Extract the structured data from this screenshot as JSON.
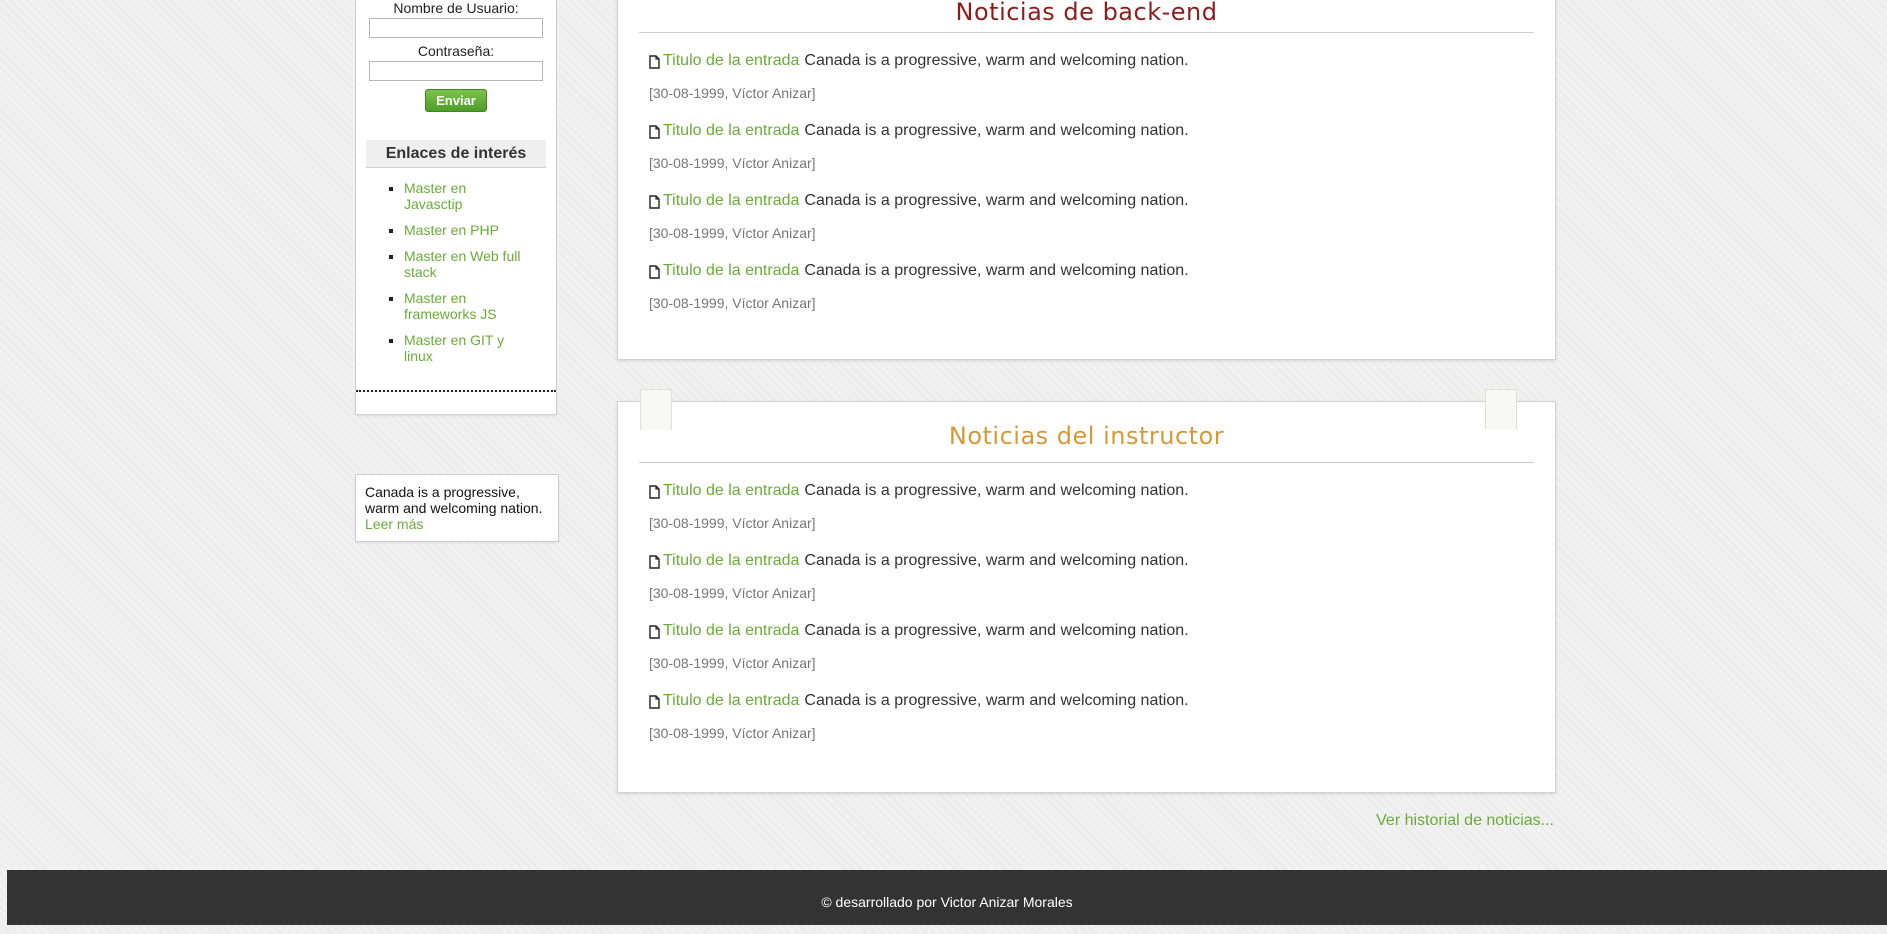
{
  "login": {
    "username_label": "Nombre de Usuario:",
    "password_label": "Contraseña:",
    "username_value": "",
    "password_value": "",
    "submit_label": "Enviar"
  },
  "links": {
    "title": "Enlaces de interés",
    "items": [
      {
        "label": "Master en Javasctip"
      },
      {
        "label": "Master en PHP"
      },
      {
        "label": "Master en Web full stack"
      },
      {
        "label": "Master en frameworks JS"
      },
      {
        "label": "Master en GIT y linux"
      }
    ]
  },
  "promo": {
    "text": "Canada is a progressive, warm and welcoming nation.",
    "link": "Leer más"
  },
  "sections": {
    "backend": {
      "title": "Noticias de back-end",
      "articles": [
        {
          "title": "Titulo de la entrada",
          "excerpt": "Canada is a progressive, warm and welcoming nation.",
          "meta": "[30-08-1999, Víctor Anizar]"
        },
        {
          "title": "Titulo de la entrada",
          "excerpt": "Canada is a progressive, warm and welcoming nation.",
          "meta": "[30-08-1999, Víctor Anizar]"
        },
        {
          "title": "Titulo de la entrada",
          "excerpt": "Canada is a progressive, warm and welcoming nation.",
          "meta": "[30-08-1999, Víctor Anizar]"
        },
        {
          "title": "Titulo de la entrada",
          "excerpt": "Canada is a progressive, warm and welcoming nation.",
          "meta": "[30-08-1999, Víctor Anizar]"
        }
      ]
    },
    "instructor": {
      "title": "Noticias del instructor",
      "articles": [
        {
          "title": "Titulo de la entrada",
          "excerpt": "Canada is a progressive, warm and welcoming nation.",
          "meta": "[30-08-1999, Víctor Anizar]"
        },
        {
          "title": "Titulo de la entrada",
          "excerpt": "Canada is a progressive, warm and welcoming nation.",
          "meta": "[30-08-1999, Víctor Anizar]"
        },
        {
          "title": "Titulo de la entrada",
          "excerpt": "Canada is a progressive, warm and welcoming nation.",
          "meta": "[30-08-1999, Víctor Anizar]"
        },
        {
          "title": "Titulo de la entrada",
          "excerpt": "Canada is a progressive, warm and welcoming nation.",
          "meta": "[30-08-1999, Víctor Anizar]"
        }
      ]
    }
  },
  "history_link": "Ver historial de noticias...",
  "footer": {
    "text": "© desarrollado por Victor Anizar Morales"
  },
  "icons": {
    "article": "document-icon"
  },
  "colors": {
    "link_green": "#6aab3a",
    "backend_title": "#8b1d1d",
    "instructor_title": "#d39a3a",
    "footer_bg": "#333333",
    "button_green": "#5cac33"
  }
}
